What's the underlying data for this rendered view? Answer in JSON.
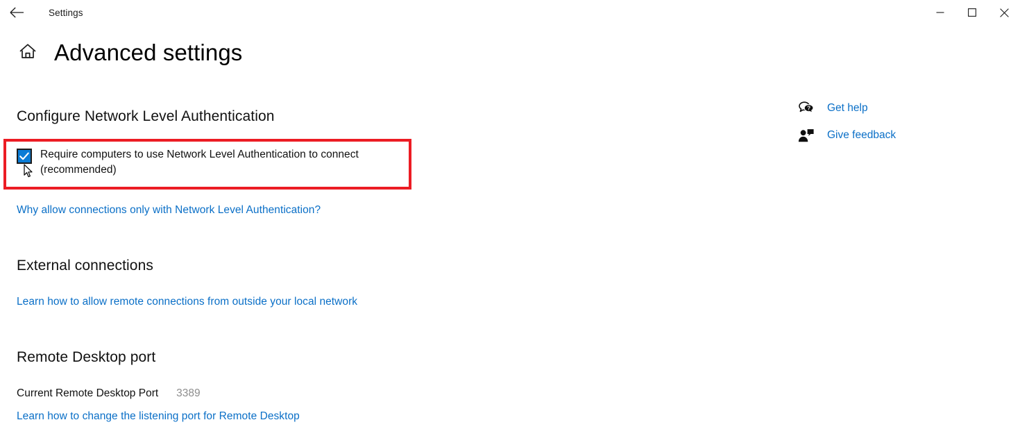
{
  "window": {
    "app_title": "Settings",
    "back_icon": "back-arrow-icon",
    "controls": {
      "minimize_icon": "minimize-icon",
      "maximize_icon": "maximize-icon",
      "close_icon": "close-icon"
    }
  },
  "header": {
    "home_icon": "home-icon",
    "title": "Advanced settings"
  },
  "sections": {
    "nla": {
      "heading": "Configure Network Level Authentication",
      "checkbox": {
        "label": "Require computers to use Network Level Authentication to connect (recommended)",
        "checked": true,
        "check_icon": "checkmark-icon",
        "highlight_color": "#ec1c24",
        "accent_color": "#0a7cd6"
      },
      "link": "Why allow connections only with Network Level Authentication?"
    },
    "external": {
      "heading": "External connections",
      "link": "Learn how to allow remote connections from outside your local network"
    },
    "port": {
      "heading": "Remote Desktop port",
      "label": "Current Remote Desktop Port",
      "value": "3389",
      "link": "Learn how to change the listening port for Remote Desktop"
    }
  },
  "aside": {
    "items": [
      {
        "icon": "help-bubble-icon",
        "label": "Get help"
      },
      {
        "icon": "feedback-person-icon",
        "label": "Give feedback"
      }
    ]
  },
  "colors": {
    "link": "#0a6fc7",
    "accent": "#0a7cd6",
    "highlight": "#ec1c24",
    "muted_text": "#8d8d8d"
  },
  "cursor": {
    "icon": "mouse-pointer-icon"
  }
}
